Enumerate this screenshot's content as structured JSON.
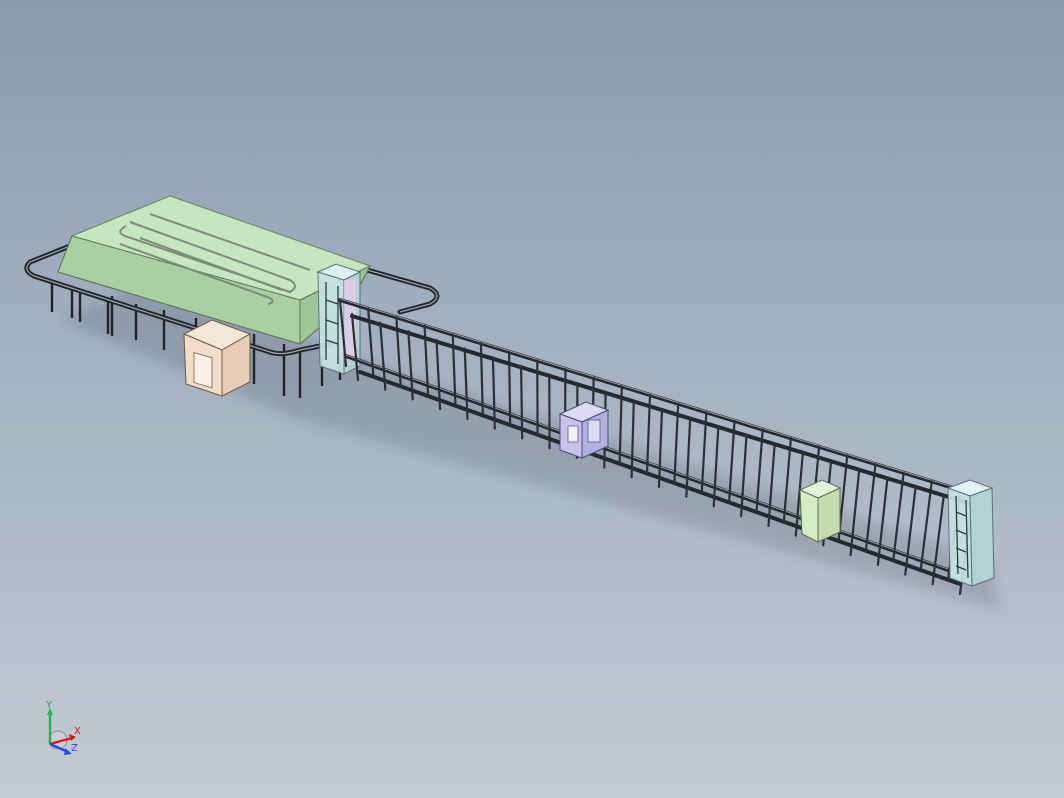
{
  "viewport": {
    "background_top": "#8a9bb0",
    "background_bottom": "#c3cad3"
  },
  "model": {
    "components": [
      {
        "name": "drying-oven-canopy",
        "color": "#b5dcae"
      },
      {
        "name": "operator-booth",
        "color": "#f3dcc8"
      },
      {
        "name": "lift-tower-left",
        "color": "#c6e3e3"
      },
      {
        "name": "spray-booth-frame",
        "color": "#c7c3ea"
      },
      {
        "name": "control-cabinet",
        "color": "#d7ecc4"
      },
      {
        "name": "lift-tower-right",
        "color": "#c6e3e3"
      },
      {
        "name": "conveyor-track",
        "color": "#2a2f36"
      }
    ]
  },
  "axis_triad": {
    "x_label": "X",
    "y_label": "Y",
    "z_label": "Z",
    "x_color": "#e0141a",
    "y_color": "#22b14c",
    "z_color": "#2050d8"
  }
}
